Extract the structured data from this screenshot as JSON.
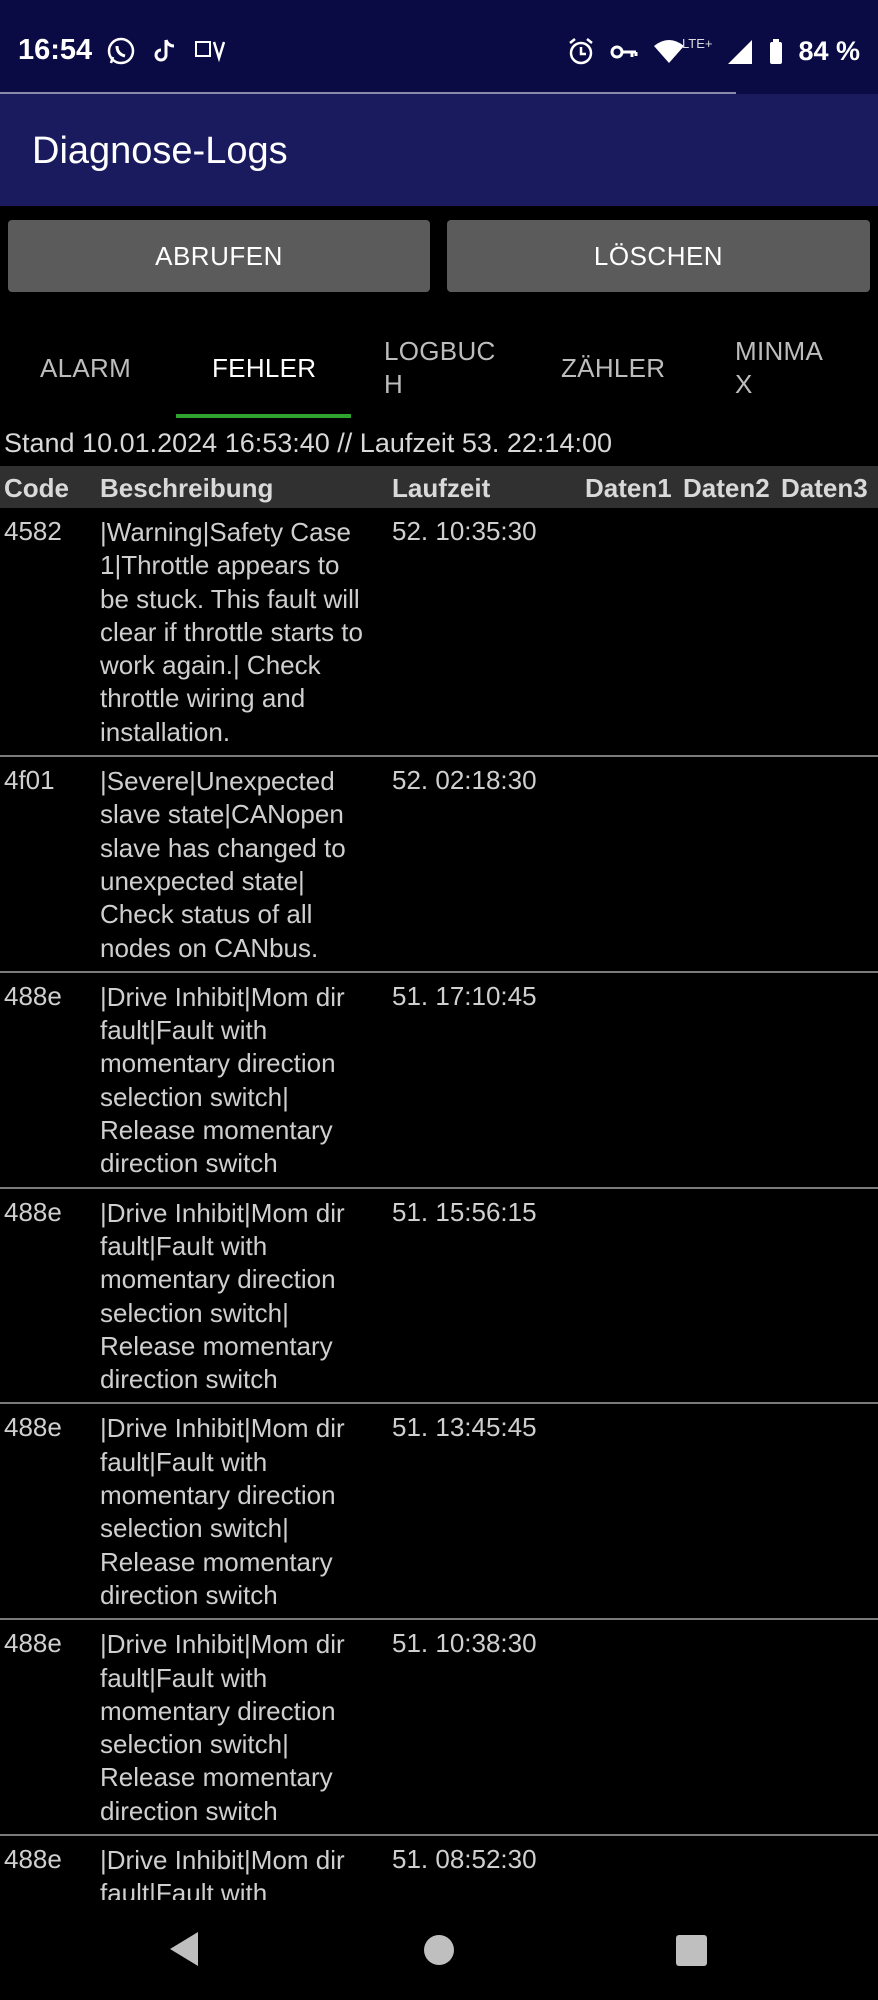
{
  "status_bar": {
    "time": "16:54",
    "left_icons": [
      "whatsapp-icon",
      "tiktok-icon",
      "tv-icon"
    ],
    "network": "LTE+",
    "battery": "84 %"
  },
  "app_bar": {
    "title": "Diagnose-Logs"
  },
  "buttons": {
    "abrufen": "ABRUFEN",
    "loeschen": "LÖSCHEN"
  },
  "tabs": [
    {
      "label": "ALARM",
      "active": false
    },
    {
      "label": "FEHLER",
      "active": true
    },
    {
      "label": "LOGBUC\nH",
      "active": false
    },
    {
      "label": "ZÄHLER",
      "active": false
    },
    {
      "label": "MINMA\nX",
      "active": false
    }
  ],
  "stand": "Stand 10.01.2024 16:53:40 // Laufzeit 53. 22:14:00",
  "table": {
    "headers": {
      "code": "Code",
      "beschreibung": "Beschreibung",
      "laufzeit": "Laufzeit",
      "daten1": "Daten1",
      "daten2": "Daten2",
      "daten3": "Daten3"
    },
    "rows": [
      {
        "code": "4582",
        "beschreibung": "|Warning|Safety Case 1|Throttle appears to be stuck. This fault will clear if throttle starts to work again.| Check throttle wiring and installation.",
        "laufzeit": "52. 10:35:30"
      },
      {
        "code": "4f01",
        "beschreibung": "|Severe|Unexpected slave state|CANopen slave has changed to unexpected state| Check status of all nodes on CANbus.",
        "laufzeit": "52. 02:18:30"
      },
      {
        "code": "488e",
        "beschreibung": "|Drive Inhibit|Mom dir fault|Fault with momentary direction selection switch| Release momentary direction switch",
        "laufzeit": "51. 17:10:45"
      },
      {
        "code": "488e",
        "beschreibung": "|Drive Inhibit|Mom dir fault|Fault with momentary direction selection switch| Release momentary direction switch",
        "laufzeit": "51. 15:56:15"
      },
      {
        "code": "488e",
        "beschreibung": "|Drive Inhibit|Mom dir fault|Fault with momentary direction selection switch| Release momentary direction switch",
        "laufzeit": "51. 13:45:45"
      },
      {
        "code": "488e",
        "beschreibung": "|Drive Inhibit|Mom dir fault|Fault with momentary direction selection switch| Release momentary direction switch",
        "laufzeit": "51. 10:38:30"
      },
      {
        "code": "488e",
        "beschreibung": "|Drive Inhibit|Mom dir fault|Fault with momentary direction selection switch| Release momentary direction switch",
        "laufzeit": "51. 08:52:30"
      }
    ]
  },
  "colors": {
    "status_bar": "#0a0a45",
    "app_bar": "#1a1a5e",
    "tab_indicator": "#2fa32f",
    "button": "#5b5b5b"
  }
}
